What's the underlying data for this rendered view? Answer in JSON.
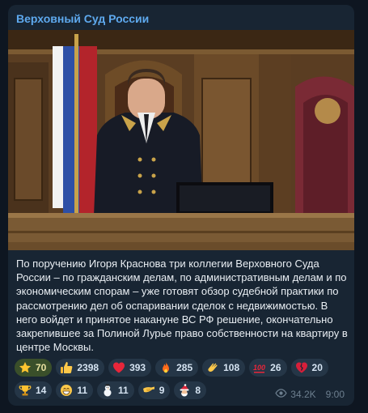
{
  "channel": {
    "name": "Верховный Суд России"
  },
  "message": {
    "text": "По поручению Игоря Краснова три коллегии Верховного Суда России – по гражданским делам, по административным делам и по экономическим спорам – уже готовят обзор судебной практики по рассмотрению дел об оспаривании сделок с недвижимостью. В него войдет и принятое накануне ВС РФ решение, окончательно закрепившее за Полиной Лурье право собственности на квартиру в центре Москвы.",
    "views": "34.2K",
    "time": "9:00"
  },
  "reactions": [
    {
      "icon": "star-icon",
      "count": "70"
    },
    {
      "icon": "thumbs-up-icon",
      "count": "2398"
    },
    {
      "icon": "heart-icon",
      "count": "393"
    },
    {
      "icon": "fire-icon",
      "count": "285"
    },
    {
      "icon": "clap-icon",
      "count": "108"
    },
    {
      "icon": "hundred-icon",
      "count": "26"
    },
    {
      "icon": "heart-broken-icon",
      "count": "20"
    },
    {
      "icon": "trophy-icon",
      "count": "14"
    },
    {
      "icon": "grin-icon",
      "count": "11"
    },
    {
      "icon": "snowman-icon",
      "count": "11"
    },
    {
      "icon": "salute-icon",
      "count": "9"
    },
    {
      "icon": "santa-icon",
      "count": "8"
    }
  ],
  "colors": {
    "channel_name": "#5ea9ee",
    "bubble": "#182533",
    "background": "#0e1621"
  }
}
